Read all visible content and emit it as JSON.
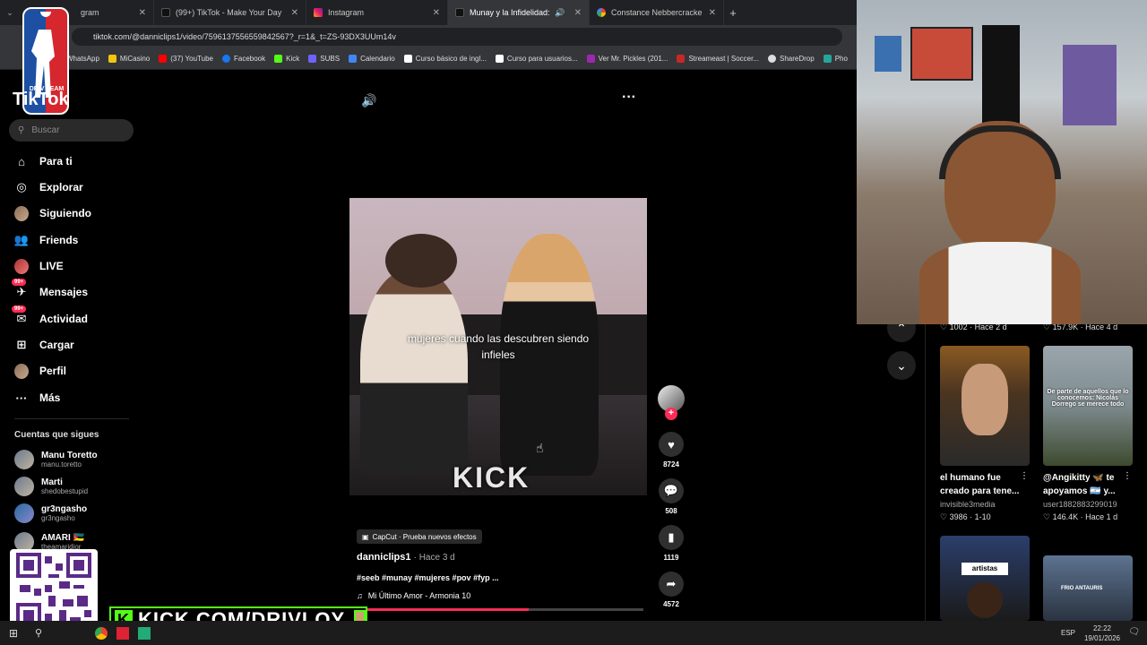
{
  "browser": {
    "tabs": [
      {
        "label": "gram",
        "active": false
      },
      {
        "label": "(99+) TikTok - Make Your Day",
        "active": false
      },
      {
        "label": "Instagram",
        "active": false
      },
      {
        "label": "Munay y la Infidelidad: Un F",
        "active": true
      },
      {
        "label": "Constance Nebbercracke - Busc",
        "active": false
      }
    ],
    "url": "tiktok.com/@danniclips1/video/7596137556559842567?_r=1&_t=ZS-93DX3UUm14v",
    "bookmarks": [
      "WhatsApp",
      "MiCasino",
      "(37) YouTube",
      "Facebook",
      "Kick",
      "SUBS",
      "Calendario",
      "Curso básico de ingl...",
      "Curso para usuarios...",
      "Ver Mr. Pickles (201...",
      "Streameast | Soccer...",
      "ShareDrop",
      "Pho"
    ]
  },
  "sidebar": {
    "logo": "TikTok",
    "search_placeholder": "Buscar",
    "nav": [
      {
        "label": "Para ti",
        "icon": "home-icon"
      },
      {
        "label": "Explorar",
        "icon": "compass-icon"
      },
      {
        "label": "Siguiendo",
        "icon": "following-avatar-icon"
      },
      {
        "label": "Friends",
        "icon": "friends-icon"
      },
      {
        "label": "LIVE",
        "icon": "live-icon"
      },
      {
        "label": "Mensajes",
        "icon": "messages-icon",
        "badge": "99+"
      },
      {
        "label": "Actividad",
        "icon": "activity-icon",
        "badge": "99+"
      },
      {
        "label": "Cargar",
        "icon": "upload-icon"
      },
      {
        "label": "Perfil",
        "icon": "profile-icon"
      },
      {
        "label": "Más",
        "icon": "more-icon"
      }
    ],
    "following_title": "Cuentas que sigues",
    "following": [
      {
        "name": "Manu Toretto",
        "handle": "manu.toretto"
      },
      {
        "name": "Marti",
        "handle": "shedobestupid"
      },
      {
        "name": "gr3ngasho",
        "handle": "gr3ngasho"
      },
      {
        "name": "AMARI 🇲🇿",
        "handle": "theamaridior"
      }
    ]
  },
  "video": {
    "caption": "mujeres cuando las descubren siendo infieles",
    "watermark": "KICK",
    "capcut": "CapCut · Prueba nuevos efectos",
    "author": "danniclips1",
    "time": "· Hace 3 d",
    "tags": "#seeb #munay #mujeres #pov #fyp ...",
    "music": "Mi Último Amor - Armonia 10",
    "progress": 0.6,
    "actions": [
      {
        "name": "like",
        "icon": "heart-icon",
        "count": "8724"
      },
      {
        "name": "comment",
        "icon": "comment-icon",
        "count": "508"
      },
      {
        "name": "save",
        "icon": "bookmark-icon",
        "count": "1119"
      },
      {
        "name": "share",
        "icon": "share-icon",
        "count": "4572"
      }
    ]
  },
  "related": {
    "top_meta": [
      {
        "likes": "1002",
        "time": "Hace 2 d"
      },
      {
        "likes": "157.9K",
        "time": "Hace 4 d"
      }
    ],
    "items": [
      {
        "title": "el humano fue creado para tene...",
        "user": "invisible3media",
        "likes": "3986",
        "time": "1-10",
        "overlay": ""
      },
      {
        "title": "@Angikitty 🦋 te apoyamos 🇦🇷 y...",
        "user": "user1882883299019",
        "likes": "146.4K",
        "time": "Hace 1 d",
        "overlay": "De parte de aquellos que lo conocemos: Nicolás Dorrego se merece todo"
      },
      {
        "title": "",
        "user": "",
        "likes": "",
        "time": "",
        "overlay": "artistas"
      },
      {
        "title": "",
        "user": "",
        "likes": "",
        "time": "",
        "overlay": "FRIO ANTAURIS"
      }
    ]
  },
  "overlay": {
    "kick_banner": "KICK.COM/DRIVLOY",
    "logo_text": "DRIV TEAM"
  },
  "taskbar": {
    "lang": "ESP",
    "time": "22:22",
    "date": "19/01/2026"
  }
}
